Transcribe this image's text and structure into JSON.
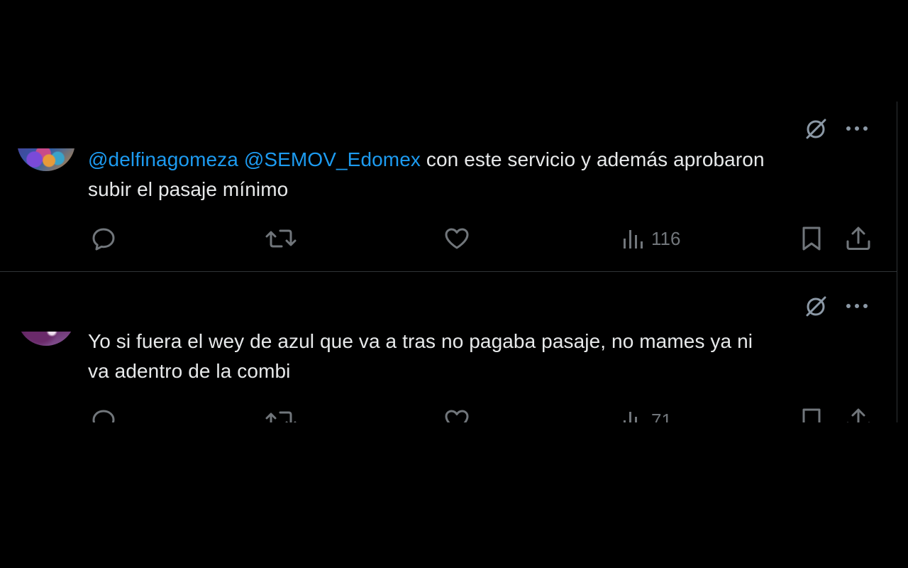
{
  "tweets": [
    {
      "mentions": [
        "@delfinagomeza",
        "@SEMOV_Edomex"
      ],
      "text_line1_rest": " con este servicio y además aprobaron",
      "text_line2": "subir el pasaje mínimo",
      "views": "116"
    },
    {
      "text_line1": "Yo si fuera el wey de azul que va a tras no pagaba pasaje, no mames ya ni",
      "text_line2": "va adentro de la combi",
      "views": "71"
    }
  ],
  "icons": {
    "grok": "grok-icon",
    "more": "more-icon",
    "reply": "reply-icon",
    "retweet": "retweet-icon",
    "like": "heart-icon",
    "views": "views-icon",
    "bookmark": "bookmark-icon",
    "share": "share-icon"
  },
  "colors": {
    "background": "#000000",
    "text": "#e7e9ea",
    "mention": "#1d9bf0",
    "muted": "#71767b",
    "border": "#2f3336"
  }
}
